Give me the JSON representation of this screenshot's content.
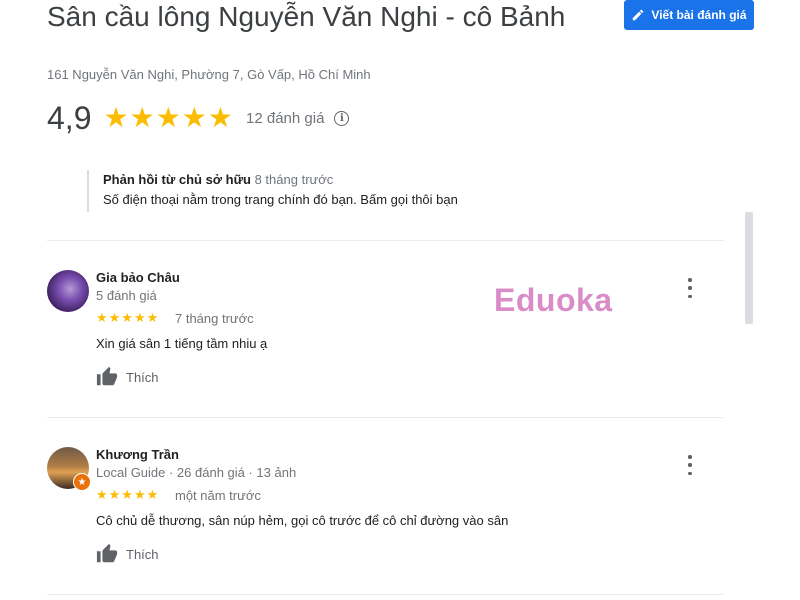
{
  "place": {
    "title": "Sân cầu lông Nguyễn Văn Nghi - cô Bảnh",
    "address": "161 Nguyễn Văn Nghi, Phường 7, Gò Vấp, Hồ Chí Minh",
    "rating": "4,9",
    "stars": "★★★★★",
    "review_count": "12 đánh giá",
    "info_icon": "i"
  },
  "toolbar": {
    "write_review_label": "Viết bài đánh giá"
  },
  "owner_reply": {
    "label": "Phản hồi từ chủ sở hữu",
    "time": "8 tháng trước",
    "text": "Số điện thoại nằm trong trang chính đó bạn. Bấm gọi thôi bạn"
  },
  "reviews": [
    {
      "name": "Gia bảo Châu",
      "meta": "5 đánh giá",
      "stars": "★★★★★",
      "time": "7 tháng trước",
      "text": "Xin giá sân 1 tiếng tầm nhiu ạ",
      "like_label": "Thích"
    },
    {
      "name": "Khương Trần",
      "meta": "Local Guide · 26 đánh giá · 13 ảnh",
      "stars": "★★★★★",
      "time": "một năm trước",
      "text": "Cô chủ dễ thương, sân núp hẻm, gọi cô trước để cô chỉ đường vào sân",
      "like_label": "Thích",
      "badge": "★"
    }
  ],
  "watermark": "Eduoka",
  "colors": {
    "accent": "#1a73e8",
    "star": "#fbbc04",
    "watermark": "#d98cc8"
  }
}
